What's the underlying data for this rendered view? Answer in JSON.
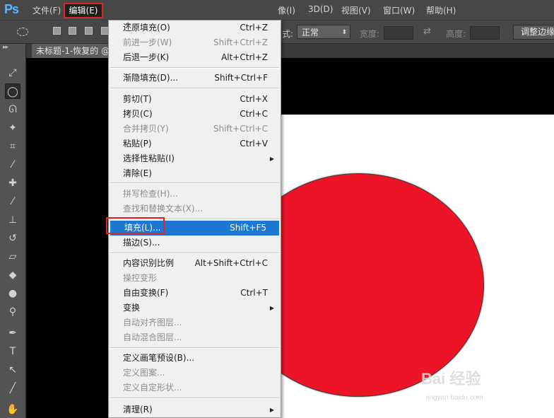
{
  "app": {
    "logo": "Ps"
  },
  "menubar": {
    "file": "文件(F)",
    "edit": "编辑(E)",
    "image_partial": "像(I)",
    "three_d": "3D(D)",
    "view": "视图(V)",
    "window": "窗口(W)",
    "help": "帮助(H)"
  },
  "options": {
    "style_label": "式:",
    "style_value": "正常",
    "width_label": "宽度:",
    "height_label": "高度:",
    "refine_edge": "调整边缘"
  },
  "document": {
    "tab_title": "未标题-1-恢复的 @"
  },
  "canvas": {
    "circle_color": "#ee1427"
  },
  "edit_menu": {
    "undo": {
      "label": "还原填充(O)",
      "shortcut": "Ctrl+Z"
    },
    "step_forward": {
      "label": "前进一步(W)",
      "shortcut": "Shift+Ctrl+Z"
    },
    "step_backward": {
      "label": "后退一步(K)",
      "shortcut": "Alt+Ctrl+Z"
    },
    "fade": {
      "label": "渐隐填充(D)...",
      "shortcut": "Shift+Ctrl+F"
    },
    "cut": {
      "label": "剪切(T)",
      "shortcut": "Ctrl+X"
    },
    "copy": {
      "label": "拷贝(C)",
      "shortcut": "Ctrl+C"
    },
    "copy_merged": {
      "label": "合并拷贝(Y)",
      "shortcut": "Shift+Ctrl+C"
    },
    "paste": {
      "label": "粘贴(P)",
      "shortcut": "Ctrl+V"
    },
    "paste_special": {
      "label": "选择性粘贴(I)"
    },
    "clear": {
      "label": "清除(E)"
    },
    "spell_check": {
      "label": "拼写检查(H)..."
    },
    "find_replace": {
      "label": "查找和替换文本(X)..."
    },
    "fill": {
      "label": "填充(L)...",
      "shortcut": "Shift+F5"
    },
    "stroke": {
      "label": "描边(S)..."
    },
    "content_aware_scale": {
      "label": "内容识别比例",
      "shortcut": "Alt+Shift+Ctrl+C"
    },
    "puppet_warp": {
      "label": "操控变形"
    },
    "free_transform": {
      "label": "自由变换(F)",
      "shortcut": "Ctrl+T"
    },
    "transform": {
      "label": "变换"
    },
    "auto_align": {
      "label": "自动对齐图层..."
    },
    "auto_blend": {
      "label": "自动混合图层..."
    },
    "define_brush": {
      "label": "定义画笔预设(B)..."
    },
    "define_pattern": {
      "label": "定义图案..."
    },
    "define_shape": {
      "label": "定义自定形状..."
    },
    "purge": {
      "label": "清理(R)"
    }
  },
  "watermark": {
    "text": "Bai 经验",
    "sub": "jingyan.baidu.com"
  },
  "colors": {
    "highlight": "#1e78d2",
    "annotation": "#e0262b"
  }
}
